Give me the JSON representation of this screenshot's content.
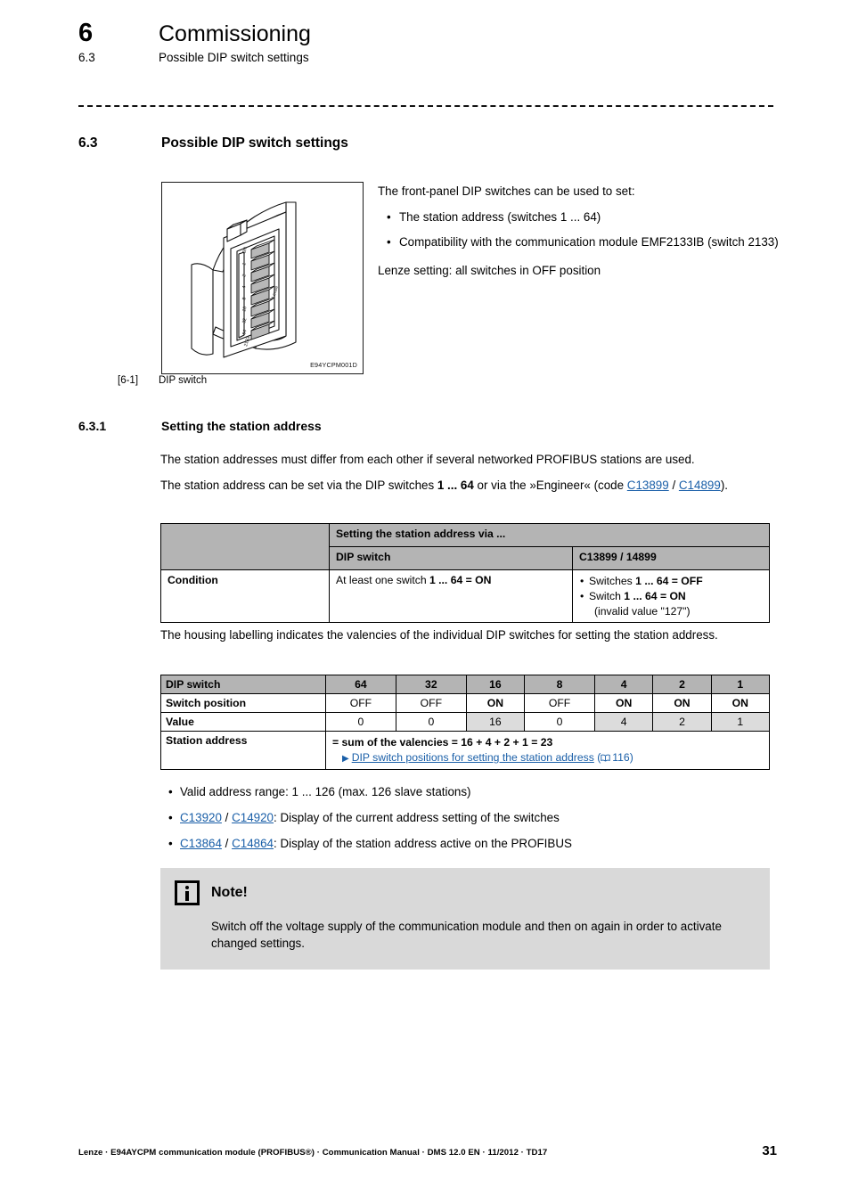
{
  "header": {
    "chapter_number": "6",
    "chapter_title": "Commissioning",
    "section_number": "6.3",
    "section_title": "Possible DIP switch settings"
  },
  "section": {
    "number": "6.3",
    "title": "Possible DIP switch settings"
  },
  "figure": {
    "image_id": "E94YCPM001D",
    "caption_number": "[6-1]",
    "caption_text": "DIP switch"
  },
  "intro": {
    "lead": "The front-panel DIP switches can be used to set:",
    "bullets": [
      "The station address (switches 1 ... 64)",
      "Compatibility with the communication module EMF2133IB (switch 2133)"
    ],
    "tail": "Lenze setting: all switches in OFF position"
  },
  "subsection": {
    "number": "6.3.1",
    "title": "Setting the station address",
    "para1": "The station addresses must differ from each other if several networked PROFIBUS stations are used.",
    "para2_a": "The station address can be set via the DIP switches ",
    "para2_bold": "1 ... 64",
    "para2_b": " or via the »Engineer« (code ",
    "para2_link1": "C13899",
    "para2_sep": " / ",
    "para2_link2": "C14899",
    "para2_c": ")."
  },
  "table_condition": {
    "header_blank": "",
    "header_span": "Setting the station address via ...",
    "subheader_col1": "DIP switch",
    "subheader_col2": "C13899 / 14899",
    "row_label": "Condition",
    "cell_dip": {
      "text_a": "At least one switch ",
      "bold": "1 ... 64 = ON"
    },
    "cell_code_bullets": [
      {
        "text_a": "Switches ",
        "bold": "1 ... 64 = OFF",
        "text_b": ""
      },
      {
        "text_a": "Switch ",
        "bold": "1 ... 64 = ON",
        "text_b": ""
      }
    ],
    "cell_code_note": "(invalid value \"127\")"
  },
  "valency_intro": "The housing labelling indicates the valencies of the individual DIP switches for setting the station address.",
  "chart_data": {
    "type": "table",
    "title": "DIP switch valencies",
    "row_labels": [
      "DIP switch",
      "Switch position",
      "Value",
      "Station address"
    ],
    "categories": [
      "64",
      "32",
      "16",
      "8",
      "4",
      "2",
      "1"
    ],
    "series": [
      {
        "name": "Switch position",
        "values": [
          "OFF",
          "OFF",
          "ON",
          "OFF",
          "ON",
          "ON",
          "ON"
        ]
      },
      {
        "name": "Value",
        "values": [
          "0",
          "0",
          "16",
          "0",
          "4",
          "2",
          "1"
        ]
      }
    ],
    "highlighted": [
      false,
      false,
      true,
      false,
      true,
      true,
      true
    ],
    "station_address_sum": "= sum of the valencies = 16 + 4 + 2 + 1 = 23",
    "station_address_value": 23,
    "cross_reference": "DIP switch positions for setting the station address",
    "cross_reference_page": "116"
  },
  "post_bullets": [
    {
      "plain": "Valid address range: 1 ... 126 (max. 126 slave stations)"
    },
    {
      "link1": "C13920",
      "sep": " / ",
      "link2": "C14920",
      "rest": ": Display of the current address setting of the switches"
    },
    {
      "link1": "C13864",
      "sep": " / ",
      "link2": "C14864",
      "rest": ": Display of the station address active on the PROFIBUS"
    }
  ],
  "note": {
    "icon": "info-icon",
    "title": "Note!",
    "body": "Switch off the voltage supply of the communication module and then on again in order to activate changed settings."
  },
  "footer": {
    "text": "Lenze · E94AYCPM communication module (PROFIBUS®) · Communication Manual · DMS 12.0 EN · 11/2012 · TD17",
    "page_number": "31"
  },
  "colors": {
    "link": "#1a5fa8",
    "table_header": "#b4b4b4",
    "value_highlight": "#dcdcdc",
    "note_background": "#d9d9d9"
  }
}
